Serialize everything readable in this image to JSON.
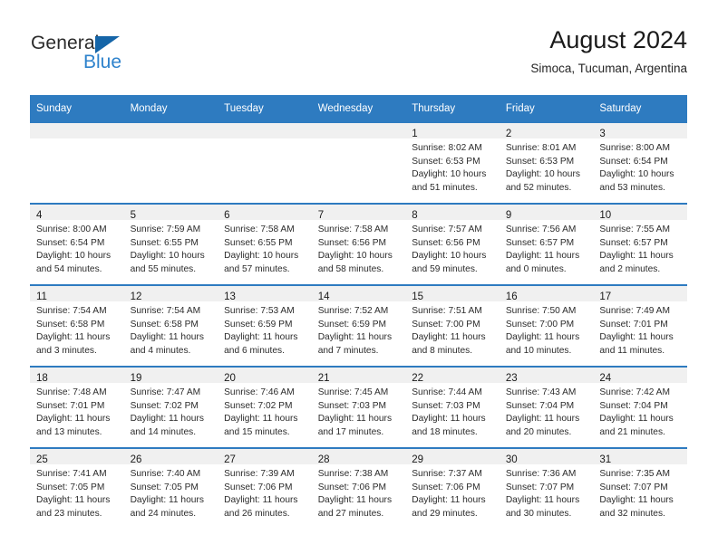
{
  "brand": {
    "name_top": "General",
    "name_bottom": "Blue",
    "accent_color": "#2d82cc",
    "triangle_color": "#1565a8"
  },
  "header": {
    "title": "August 2024",
    "subtitle": "Simoca, Tucuman, Argentina"
  },
  "theme": {
    "header_blue": "#2e7bc0",
    "band_gray": "#f0f0f0",
    "text_dark": "#2b2b2b"
  },
  "weekdays": [
    "Sunday",
    "Monday",
    "Tuesday",
    "Wednesday",
    "Thursday",
    "Friday",
    "Saturday"
  ],
  "weeks": [
    [
      {
        "day": "",
        "lines": []
      },
      {
        "day": "",
        "lines": []
      },
      {
        "day": "",
        "lines": []
      },
      {
        "day": "",
        "lines": []
      },
      {
        "day": "1",
        "lines": [
          "Sunrise: 8:02 AM",
          "Sunset: 6:53 PM",
          "Daylight: 10 hours",
          "and 51 minutes."
        ]
      },
      {
        "day": "2",
        "lines": [
          "Sunrise: 8:01 AM",
          "Sunset: 6:53 PM",
          "Daylight: 10 hours",
          "and 52 minutes."
        ]
      },
      {
        "day": "3",
        "lines": [
          "Sunrise: 8:00 AM",
          "Sunset: 6:54 PM",
          "Daylight: 10 hours",
          "and 53 minutes."
        ]
      }
    ],
    [
      {
        "day": "4",
        "lines": [
          "Sunrise: 8:00 AM",
          "Sunset: 6:54 PM",
          "Daylight: 10 hours",
          "and 54 minutes."
        ]
      },
      {
        "day": "5",
        "lines": [
          "Sunrise: 7:59 AM",
          "Sunset: 6:55 PM",
          "Daylight: 10 hours",
          "and 55 minutes."
        ]
      },
      {
        "day": "6",
        "lines": [
          "Sunrise: 7:58 AM",
          "Sunset: 6:55 PM",
          "Daylight: 10 hours",
          "and 57 minutes."
        ]
      },
      {
        "day": "7",
        "lines": [
          "Sunrise: 7:58 AM",
          "Sunset: 6:56 PM",
          "Daylight: 10 hours",
          "and 58 minutes."
        ]
      },
      {
        "day": "8",
        "lines": [
          "Sunrise: 7:57 AM",
          "Sunset: 6:56 PM",
          "Daylight: 10 hours",
          "and 59 minutes."
        ]
      },
      {
        "day": "9",
        "lines": [
          "Sunrise: 7:56 AM",
          "Sunset: 6:57 PM",
          "Daylight: 11 hours",
          "and 0 minutes."
        ]
      },
      {
        "day": "10",
        "lines": [
          "Sunrise: 7:55 AM",
          "Sunset: 6:57 PM",
          "Daylight: 11 hours",
          "and 2 minutes."
        ]
      }
    ],
    [
      {
        "day": "11",
        "lines": [
          "Sunrise: 7:54 AM",
          "Sunset: 6:58 PM",
          "Daylight: 11 hours",
          "and 3 minutes."
        ]
      },
      {
        "day": "12",
        "lines": [
          "Sunrise: 7:54 AM",
          "Sunset: 6:58 PM",
          "Daylight: 11 hours",
          "and 4 minutes."
        ]
      },
      {
        "day": "13",
        "lines": [
          "Sunrise: 7:53 AM",
          "Sunset: 6:59 PM",
          "Daylight: 11 hours",
          "and 6 minutes."
        ]
      },
      {
        "day": "14",
        "lines": [
          "Sunrise: 7:52 AM",
          "Sunset: 6:59 PM",
          "Daylight: 11 hours",
          "and 7 minutes."
        ]
      },
      {
        "day": "15",
        "lines": [
          "Sunrise: 7:51 AM",
          "Sunset: 7:00 PM",
          "Daylight: 11 hours",
          "and 8 minutes."
        ]
      },
      {
        "day": "16",
        "lines": [
          "Sunrise: 7:50 AM",
          "Sunset: 7:00 PM",
          "Daylight: 11 hours",
          "and 10 minutes."
        ]
      },
      {
        "day": "17",
        "lines": [
          "Sunrise: 7:49 AM",
          "Sunset: 7:01 PM",
          "Daylight: 11 hours",
          "and 11 minutes."
        ]
      }
    ],
    [
      {
        "day": "18",
        "lines": [
          "Sunrise: 7:48 AM",
          "Sunset: 7:01 PM",
          "Daylight: 11 hours",
          "and 13 minutes."
        ]
      },
      {
        "day": "19",
        "lines": [
          "Sunrise: 7:47 AM",
          "Sunset: 7:02 PM",
          "Daylight: 11 hours",
          "and 14 minutes."
        ]
      },
      {
        "day": "20",
        "lines": [
          "Sunrise: 7:46 AM",
          "Sunset: 7:02 PM",
          "Daylight: 11 hours",
          "and 15 minutes."
        ]
      },
      {
        "day": "21",
        "lines": [
          "Sunrise: 7:45 AM",
          "Sunset: 7:03 PM",
          "Daylight: 11 hours",
          "and 17 minutes."
        ]
      },
      {
        "day": "22",
        "lines": [
          "Sunrise: 7:44 AM",
          "Sunset: 7:03 PM",
          "Daylight: 11 hours",
          "and 18 minutes."
        ]
      },
      {
        "day": "23",
        "lines": [
          "Sunrise: 7:43 AM",
          "Sunset: 7:04 PM",
          "Daylight: 11 hours",
          "and 20 minutes."
        ]
      },
      {
        "day": "24",
        "lines": [
          "Sunrise: 7:42 AM",
          "Sunset: 7:04 PM",
          "Daylight: 11 hours",
          "and 21 minutes."
        ]
      }
    ],
    [
      {
        "day": "25",
        "lines": [
          "Sunrise: 7:41 AM",
          "Sunset: 7:05 PM",
          "Daylight: 11 hours",
          "and 23 minutes."
        ]
      },
      {
        "day": "26",
        "lines": [
          "Sunrise: 7:40 AM",
          "Sunset: 7:05 PM",
          "Daylight: 11 hours",
          "and 24 minutes."
        ]
      },
      {
        "day": "27",
        "lines": [
          "Sunrise: 7:39 AM",
          "Sunset: 7:06 PM",
          "Daylight: 11 hours",
          "and 26 minutes."
        ]
      },
      {
        "day": "28",
        "lines": [
          "Sunrise: 7:38 AM",
          "Sunset: 7:06 PM",
          "Daylight: 11 hours",
          "and 27 minutes."
        ]
      },
      {
        "day": "29",
        "lines": [
          "Sunrise: 7:37 AM",
          "Sunset: 7:06 PM",
          "Daylight: 11 hours",
          "and 29 minutes."
        ]
      },
      {
        "day": "30",
        "lines": [
          "Sunrise: 7:36 AM",
          "Sunset: 7:07 PM",
          "Daylight: 11 hours",
          "and 30 minutes."
        ]
      },
      {
        "day": "31",
        "lines": [
          "Sunrise: 7:35 AM",
          "Sunset: 7:07 PM",
          "Daylight: 11 hours",
          "and 32 minutes."
        ]
      }
    ]
  ]
}
